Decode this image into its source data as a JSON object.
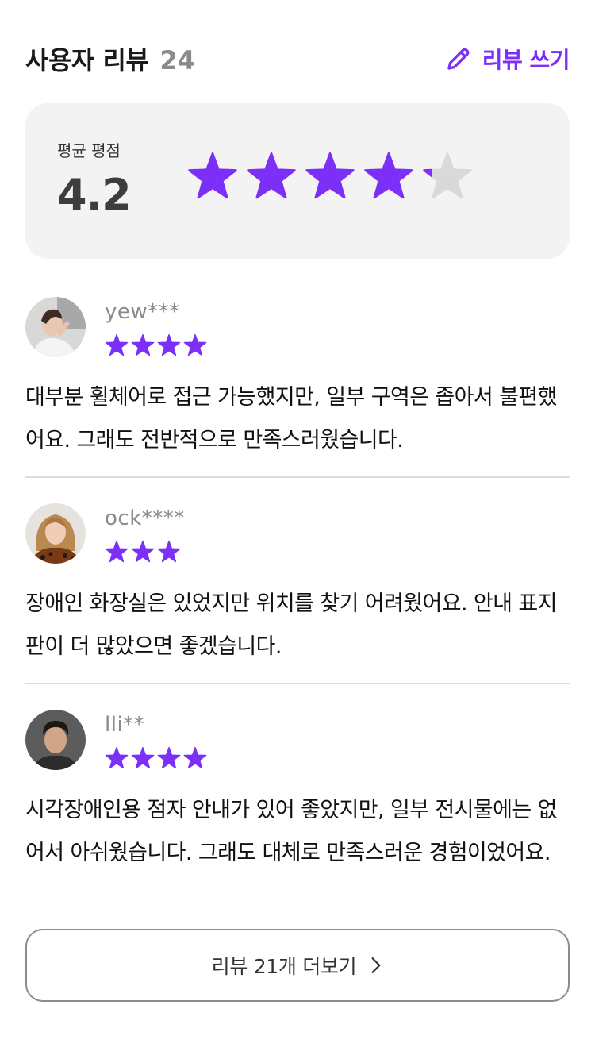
{
  "header": {
    "title": "사용자 리뷰",
    "count": "24",
    "write_label": "리뷰 쓰기"
  },
  "summary": {
    "label": "평균 평점",
    "average": "4.2",
    "rating": 4.2,
    "max": 5
  },
  "colors": {
    "accent": "#7b2ff7",
    "star_empty": "#d9d9d9"
  },
  "reviews": [
    {
      "username": "yew***",
      "rating": 4,
      "text": "대부분 휠체어로 접근 가능했지만, 일부 구역은 좁아서 불편했어요. 그래도 전반적으로 만족스러웠습니다."
    },
    {
      "username": "ock****",
      "rating": 3,
      "text": "장애인 화장실은 있었지만 위치를 찾기 어려웠어요. 안내 표지판이 더 많았으면 좋겠습니다."
    },
    {
      "username": "lli**",
      "rating": 4,
      "text": "시각장애인용 점자 안내가 있어 좋았지만, 일부 전시물에는 없어서 아쉬웠습니다. 그래도 대체로 만족스러운 경험이었어요."
    }
  ],
  "more": {
    "label": "리뷰 21개 더보기",
    "icon": "chevron-right-icon"
  }
}
